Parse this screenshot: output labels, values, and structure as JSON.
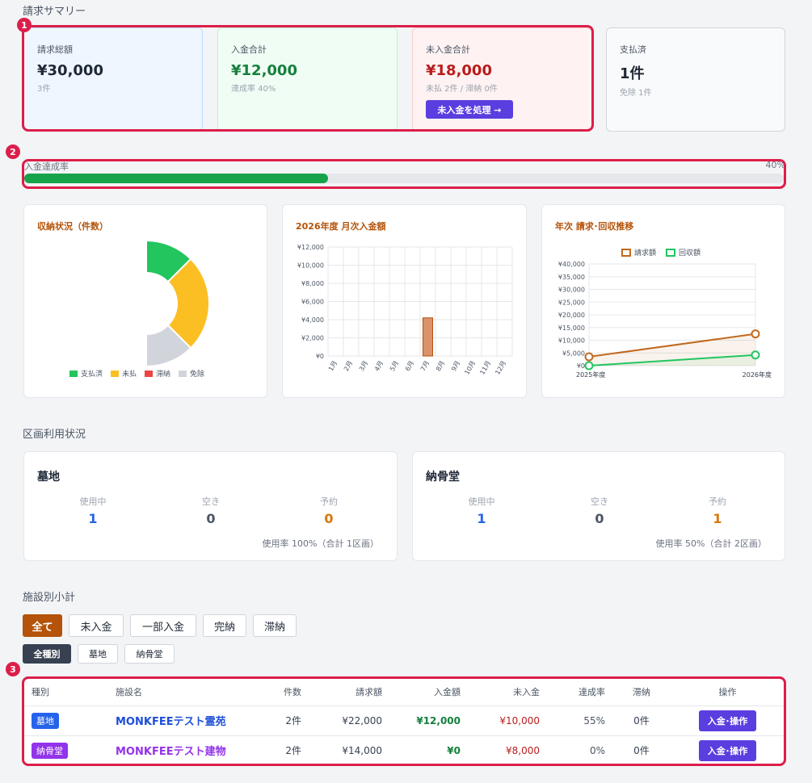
{
  "summary": {
    "title": "請求サマリー",
    "cards": [
      {
        "label": "請求総額",
        "value": "¥30,000",
        "sub": "3件"
      },
      {
        "label": "入金合計",
        "value": "¥12,000",
        "sub": "達成率 40%"
      },
      {
        "label": "未入金合計",
        "value": "¥18,000",
        "sub": "未払 2件 / 滞納 0件",
        "button": "未入金を処理 →"
      },
      {
        "label": "支払済",
        "value": "1件",
        "sub": "免除 1件"
      }
    ]
  },
  "markers": [
    "1",
    "2",
    "3"
  ],
  "progress": {
    "label": "入金達成率",
    "value_text": "40%",
    "fraction": 0.4
  },
  "donut": {
    "title": "収納状況（件数）",
    "legend": [
      {
        "label": "支払済",
        "color": "#22c55e"
      },
      {
        "label": "未払",
        "color": "#fbbf24"
      },
      {
        "label": "滞納",
        "color": "#ef4444"
      },
      {
        "label": "免除",
        "color": "#d1d5db"
      }
    ]
  },
  "bar_chart": {
    "title": "2026年度 月次入金額"
  },
  "line_chart": {
    "title": "年次 請求･回収推移",
    "legend": [
      {
        "label": "請求額",
        "color": "#c2691e"
      },
      {
        "label": "回収額",
        "color": "#22c55e"
      }
    ]
  },
  "chart_data": [
    {
      "type": "pie",
      "title": "収納状況（件数）",
      "categories": [
        "支払済",
        "未払",
        "滞納",
        "免除"
      ],
      "values": [
        1,
        2,
        0,
        1
      ],
      "colors": [
        "#22c55e",
        "#fbbf24",
        "#ef4444",
        "#d1d5db"
      ],
      "legend": "bottom"
    },
    {
      "type": "bar",
      "title": "2026年度 月次入金額",
      "categories": [
        "1月",
        "2月",
        "3月",
        "4月",
        "5月",
        "6月",
        "7月",
        "8月",
        "9月",
        "10月",
        "11月",
        "12月"
      ],
      "values": [
        0,
        0,
        0,
        0,
        0,
        0,
        4200,
        0,
        0,
        0,
        0,
        0
      ],
      "yticks": [
        "¥0",
        "¥2,000",
        "¥4,000",
        "¥6,000",
        "¥8,000",
        "¥10,000",
        "¥12,000"
      ],
      "ylim": [
        0,
        12000
      ],
      "grid": true
    },
    {
      "type": "line",
      "title": "年次 請求･回収推移",
      "categories": [
        "2025年度",
        "2026年度"
      ],
      "series": [
        {
          "name": "請求額",
          "values": [
            3500,
            12500
          ],
          "color": "#c2691e"
        },
        {
          "name": "回収額",
          "values": [
            0,
            4200
          ],
          "color": "#22c55e"
        }
      ],
      "yticks": [
        "¥0",
        "¥5,000",
        "¥10,000",
        "¥15,000",
        "¥20,000",
        "¥25,000",
        "¥30,000",
        "¥35,000",
        "¥40,000"
      ],
      "ylim": [
        0,
        40000
      ],
      "legend": "top",
      "grid": true
    }
  ],
  "usage": {
    "title": "区画利用状況",
    "cards": [
      {
        "name": "墓地",
        "in_use_label": "使用中",
        "in_use": "1",
        "free_label": "空き",
        "free": "0",
        "reserved_label": "予約",
        "reserved": "0",
        "footer": "使用率 100%（合計 1区画）"
      },
      {
        "name": "納骨堂",
        "in_use_label": "使用中",
        "in_use": "1",
        "free_label": "空き",
        "free": "0",
        "reserved_label": "予約",
        "reserved": "1",
        "footer": "使用率 50%（合計 2区画）"
      }
    ]
  },
  "facility": {
    "title": "施設別小計",
    "filters": [
      "全て",
      "未入金",
      "一部入金",
      "完納",
      "滞納"
    ],
    "types": [
      "全種別",
      "墓地",
      "納骨堂"
    ],
    "columns": [
      "種別",
      "施設名",
      "件数",
      "請求額",
      "入金額",
      "未入金",
      "達成率",
      "滞納",
      "操作"
    ],
    "rows": [
      {
        "type": "墓地",
        "type_color": "#2563eb",
        "name": "MONKFEEテスト霊苑",
        "name_color": "#1d4ed8",
        "count": "2件",
        "billed": "¥22,000",
        "paid": "¥12,000",
        "unpaid": "¥10,000",
        "rate": "55%",
        "overdue": "0件",
        "action": "入金･操作"
      },
      {
        "type": "納骨堂",
        "type_color": "#9333ea",
        "name": "MONKFEEテスト建物",
        "name_color": "#9333ea",
        "count": "2件",
        "billed": "¥14,000",
        "paid": "¥0",
        "unpaid": "¥8,000",
        "rate": "0%",
        "overdue": "0件",
        "action": "入金･操作"
      }
    ]
  }
}
